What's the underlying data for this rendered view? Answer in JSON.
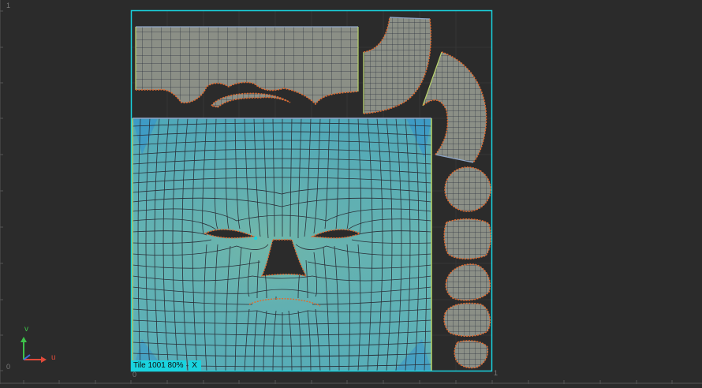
{
  "uv_editor": {
    "tile_label": "Tile 1001 80%",
    "close_label": "X",
    "axis_u": "u",
    "axis_v": "v",
    "ruler_top_left": "1",
    "ruler_bottom_left": "0",
    "ruler_bottom_origin": "0",
    "ruler_bottom_right": "1"
  },
  "colors": {
    "background": "#2b2b2b",
    "tile_border": "#19d3df",
    "shell_fill": "#8a8f88",
    "face_fill": "#5fb1b9",
    "wire": "#2a2f38",
    "seam": "#e36a2e",
    "axis_u": "#e04a3a",
    "axis_v": "#3ec24a"
  },
  "icons": {
    "axis_gizmo": "uv-axis-icon"
  }
}
